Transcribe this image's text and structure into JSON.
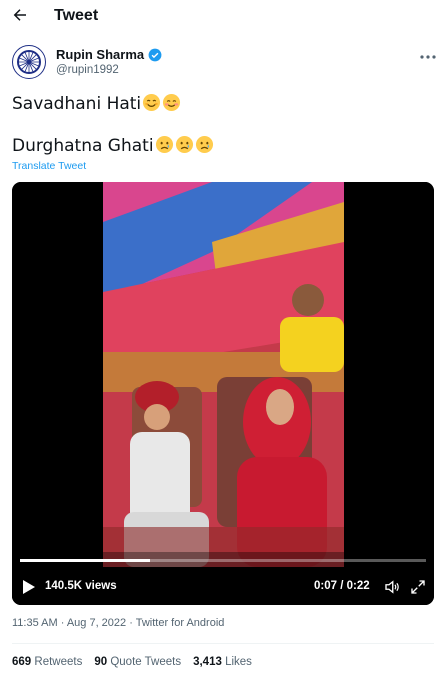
{
  "header": {
    "title": "Tweet"
  },
  "author": {
    "name": "Rupin Sharma",
    "handle": "@rupin1992"
  },
  "tweet": {
    "line1": "Savadhani Hati",
    "line1_emojis": [
      "smiling-face-icon",
      "smiling-blushing-face-icon"
    ],
    "line2": "Durghatna Ghati",
    "line2_emojis": [
      "crying-face-icon",
      "crying-face-icon",
      "crying-face-icon"
    ],
    "translate": "Translate Tweet"
  },
  "video": {
    "views": "140.5K views",
    "time": "0:07 / 0:22",
    "progress": 0.32
  },
  "meta": {
    "timestamp": "11:35 AM · Aug 7, 2022 · Twitter for Android"
  },
  "stats": {
    "retweets_count": "669",
    "retweets_label": "Retweets",
    "quotes_count": "90",
    "quotes_label": "Quote Tweets",
    "likes_count": "3,413",
    "likes_label": "Likes"
  },
  "colors": {
    "accent": "#1d9bf0",
    "text": "#0f1419",
    "muted": "#536471"
  }
}
